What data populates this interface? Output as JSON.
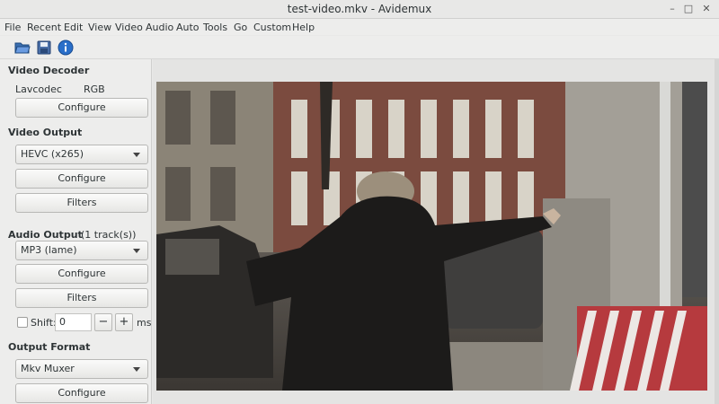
{
  "window": {
    "title": "test-video.mkv - Avidemux",
    "controls": {
      "minimize": "–",
      "maximize": "□",
      "close": "✕"
    }
  },
  "menu": [
    "File",
    "Recent",
    "Edit",
    "View",
    "Video",
    "Audio",
    "Auto",
    "Tools",
    "Go",
    "Custom",
    "Help"
  ],
  "toolbar": {
    "icons": [
      "open-folder-icon",
      "save-icon",
      "info-icon"
    ]
  },
  "video_decoder": {
    "title": "Video Decoder",
    "decoder": "Lavcodec",
    "colorspace": "RGB",
    "configure": "Configure"
  },
  "video_output": {
    "title": "Video Output",
    "codec": "HEVC (x265)",
    "configure": "Configure",
    "filters": "Filters"
  },
  "audio_output": {
    "title": "Audio Output",
    "tracks": "(1 track(s))",
    "codec": "MP3 (lame)",
    "configure": "Configure",
    "filters": "Filters",
    "shift_label": "Shift:",
    "shift_value": "0",
    "minus": "−",
    "plus": "+",
    "unit": "ms",
    "shift_checked": false
  },
  "output_format": {
    "title": "Output Format",
    "muxer": "Mkv Muxer",
    "configure": "Configure"
  },
  "colors": {
    "accent_blue": "#2a6fc9",
    "panel_bg": "#ededec"
  }
}
